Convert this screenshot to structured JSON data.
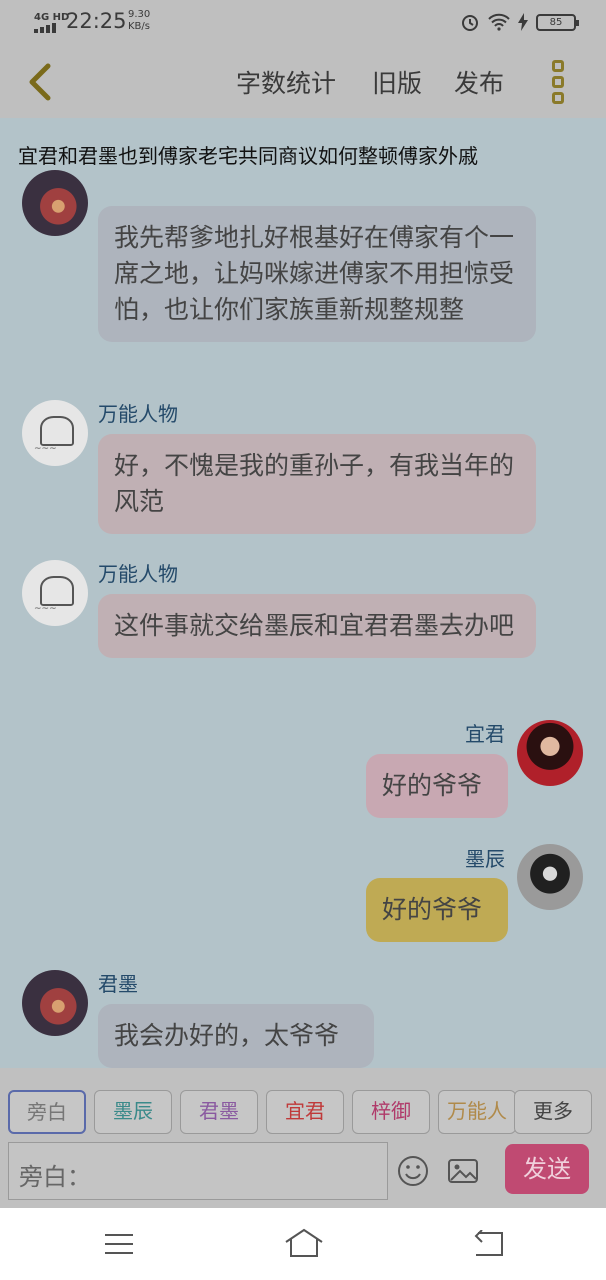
{
  "status": {
    "network": "4G HD",
    "time": "22:25",
    "speed_value": "9.30",
    "speed_unit": "KB/s",
    "battery": "85"
  },
  "toolbar": {
    "word_count": "字数统计",
    "old_version": "旧版",
    "publish": "发布"
  },
  "scene": {
    "title": "宜君和君墨也到傅家老宅共同商议如何整顿傅家外戚"
  },
  "messages": [
    {
      "speaker": "",
      "text": "我先帮爹地扎好根基好在傅家有个一席之地，让妈咪嫁进傅家不用担惊受怕，也让你们家族重新规整规整"
    },
    {
      "speaker": "万能人物",
      "text": "好，不愧是我的重孙子，有我当年的风范"
    },
    {
      "speaker": "万能人物",
      "text": "这件事就交给墨辰和宜君君墨去办吧"
    },
    {
      "speaker": "宜君",
      "text": "好的爷爷"
    },
    {
      "speaker": "墨辰",
      "text": "好的爷爷"
    },
    {
      "speaker": "君墨",
      "text": "我会办好的，太爷爷"
    }
  ],
  "characters": [
    {
      "label": "旁白",
      "color": "#777777"
    },
    {
      "label": "墨辰",
      "color": "#3a8a8a"
    },
    {
      "label": "君墨",
      "color": "#8a5aa0"
    },
    {
      "label": "宜君",
      "color": "#c03a3a"
    },
    {
      "label": "梓御",
      "color": "#b03a6a"
    },
    {
      "label": "万能人",
      "color": "#b08a4a"
    }
  ],
  "composer": {
    "more": "更多",
    "placeholder": "旁白：",
    "send": "发送"
  },
  "icons": {
    "back": "chevron-left-icon",
    "menu": "more-dots-icon",
    "emoji": "emoji-icon",
    "image": "image-icon"
  }
}
